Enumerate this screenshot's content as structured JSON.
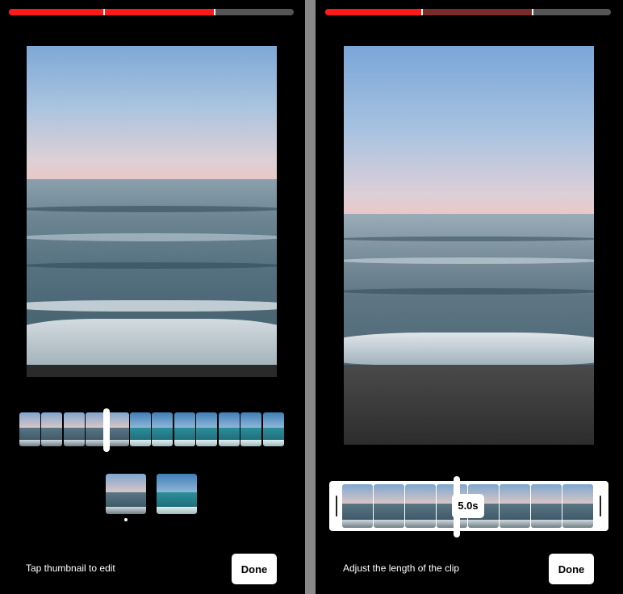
{
  "left": {
    "caption": "Tap thumbnail to edit",
    "done_label": "Done"
  },
  "right": {
    "caption": "Adjust the length of the clip",
    "done_label": "Done",
    "duration_badge": "5.0s"
  },
  "colors": {
    "progress_active": "#ff1a1a",
    "progress_partial": "#7a2a2a",
    "progress_track": "#555555",
    "background": "#000000"
  }
}
